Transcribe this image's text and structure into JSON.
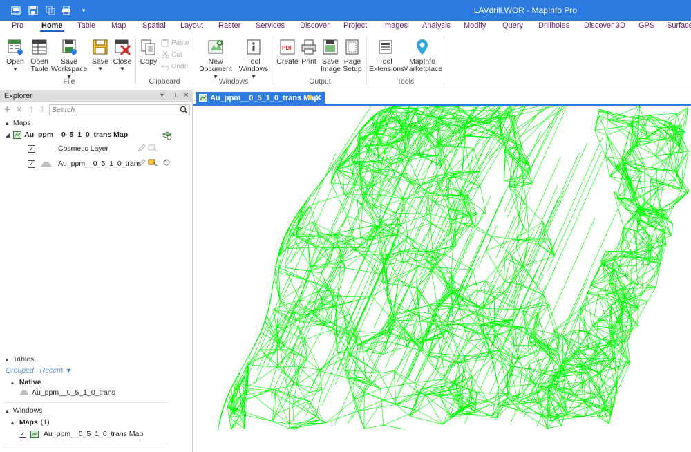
{
  "titlebar": {
    "title": "LAVdrill.WOR - MapInfo Pro",
    "quick_access": [
      "workspace-icon",
      "save-icon",
      "copy-icon",
      "print-icon",
      "customize-dropdown-icon"
    ],
    "bg_color": "#2b7be0"
  },
  "ribbon_tabs": [
    {
      "label": "Pro",
      "active": false
    },
    {
      "label": "Home",
      "active": true
    },
    {
      "label": "Table",
      "active": false
    },
    {
      "label": "Map",
      "active": false
    },
    {
      "label": "Spatial",
      "active": false
    },
    {
      "label": "Layout",
      "active": false
    },
    {
      "label": "Raster",
      "active": false
    },
    {
      "label": "Services",
      "active": false
    },
    {
      "label": "Discover",
      "active": false
    },
    {
      "label": "Project",
      "active": false
    },
    {
      "label": "Images",
      "active": false
    },
    {
      "label": "Analysis",
      "active": false
    },
    {
      "label": "Modify",
      "active": false
    },
    {
      "label": "Query",
      "active": false
    },
    {
      "label": "Drillholes",
      "active": false
    },
    {
      "label": "Discover 3D",
      "active": false
    },
    {
      "label": "GPS",
      "active": false
    },
    {
      "label": "Surface",
      "active": false
    }
  ],
  "ribbon": {
    "file": {
      "label": "File",
      "open": "Open",
      "open_table": [
        "Open",
        "Table"
      ],
      "save_workspace": [
        "Save",
        "Workspace ▾"
      ],
      "save": [
        "Save",
        "▾"
      ],
      "close": [
        "Close",
        "▾"
      ]
    },
    "clipboard": {
      "label": "Clipboard",
      "copy": "Copy",
      "paste": "Paste",
      "cut": "Cut",
      "undo": "Undo"
    },
    "windows": {
      "label": "Windows",
      "new_document": [
        "New",
        "Document ▾"
      ],
      "tool_windows": [
        "Tool",
        "Windows ▾"
      ]
    },
    "output": {
      "label": "Output",
      "create": "Create",
      "print": "Print",
      "save_image": [
        "Save",
        "Image"
      ],
      "page_setup": [
        "Page",
        "Setup"
      ]
    },
    "tools": {
      "label": "Tools",
      "tool_extensions": [
        "Tool",
        "Extensions"
      ],
      "mapinfo_marketplace": [
        "MapInfo",
        "Marketplace"
      ]
    }
  },
  "explorer": {
    "title": "Explorer",
    "search_placeholder": "Search",
    "maps_section": "Maps",
    "map_name": "Au_ppm__0_5_1_0_trans Map",
    "layers": [
      {
        "name": "Cosmetic Layer",
        "checked": true
      },
      {
        "name": "Au_ppm__0_5_1_0_trans",
        "checked": true
      }
    ],
    "tables_section": "Tables",
    "grouped_label": "Grouped : Recent",
    "native_label": "Native",
    "native_table": "Au_ppm__0_5_1_0_trans",
    "windows_section": "Windows",
    "maps_group": "Maps",
    "maps_count": "(1)",
    "window_item": "Au_ppm__0_5_1_0_trans Map"
  },
  "map_window": {
    "tab_label": "Au_ppm__0_5_1_0_trans Map",
    "wireframe_color": "#00ff00"
  }
}
